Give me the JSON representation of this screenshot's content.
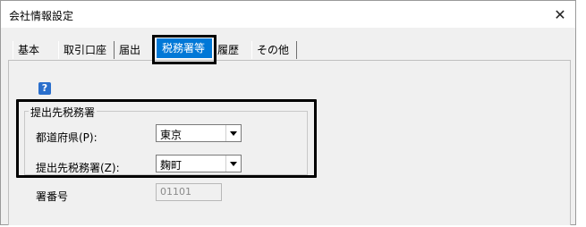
{
  "window": {
    "title": "会社情報設定",
    "close_label": "✕"
  },
  "tabs": [
    {
      "label": "基本",
      "active": false
    },
    {
      "label": "取引口座",
      "active": false
    },
    {
      "label": "届出",
      "active": false
    },
    {
      "label": "税務署等",
      "active": true
    },
    {
      "label": "履歴",
      "active": false
    },
    {
      "label": "その他",
      "active": false
    }
  ],
  "help": {
    "glyph": "?"
  },
  "tax_office_group": {
    "title": "提出先税務署",
    "prefecture": {
      "label": "都道府県(P):",
      "value": "東京"
    },
    "tax_office": {
      "label": "提出先税務署(Z):",
      "value": "麹町"
    }
  },
  "office_number": {
    "label": "署番号",
    "value": "01101"
  },
  "colors": {
    "active_tab": "#0078d7",
    "help_icon": "#2a6fcc"
  }
}
